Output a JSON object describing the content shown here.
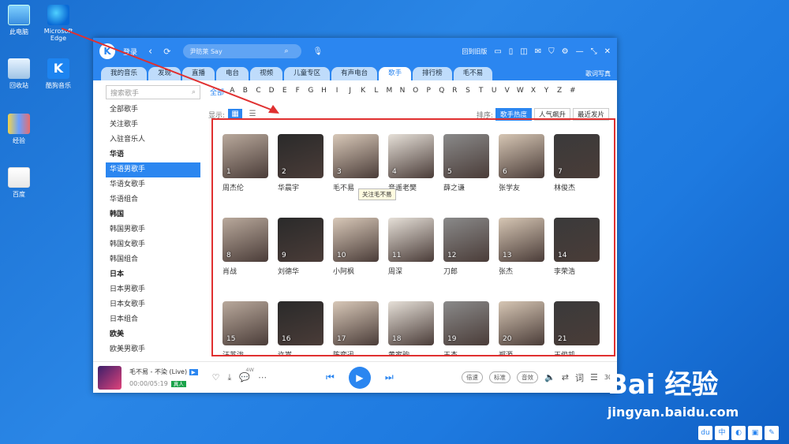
{
  "desktop": {
    "icons": [
      {
        "label": "此电脑"
      },
      {
        "label": "Microsoft Edge"
      },
      {
        "label": "回收站"
      },
      {
        "label": "酷狗音乐"
      },
      {
        "label": "经验"
      },
      {
        "label": "百度"
      }
    ]
  },
  "app": {
    "logo": "K",
    "login": "登录",
    "search_placeholder": "尹昉莱 Say",
    "back_to_old": "回到旧版",
    "tabs": [
      {
        "label": "我的音乐"
      },
      {
        "label": "发现"
      },
      {
        "label": "直播"
      },
      {
        "label": "电台"
      },
      {
        "label": "视频"
      },
      {
        "label": "儿童专区"
      },
      {
        "label": "有声电台"
      },
      {
        "label": "歌手",
        "active": true
      },
      {
        "label": "排行榜"
      },
      {
        "label": "毛不易"
      }
    ],
    "lyrics_tab": "歌词写真"
  },
  "sidebar": {
    "search_placeholder": "搜索歌手",
    "items": [
      {
        "label": "全部歌手"
      },
      {
        "label": "关注歌手"
      },
      {
        "label": "入驻音乐人"
      },
      {
        "label": "华语",
        "group": true
      },
      {
        "label": "华语男歌手",
        "active": true
      },
      {
        "label": "华语女歌手"
      },
      {
        "label": "华语组合"
      },
      {
        "label": "韩国",
        "group": true
      },
      {
        "label": "韩国男歌手"
      },
      {
        "label": "韩国女歌手"
      },
      {
        "label": "韩国组合"
      },
      {
        "label": "日本",
        "group": true
      },
      {
        "label": "日本男歌手"
      },
      {
        "label": "日本女歌手"
      },
      {
        "label": "日本组合"
      },
      {
        "label": "欧美",
        "group": true
      },
      {
        "label": "欧美男歌手"
      }
    ]
  },
  "letters": [
    "全部",
    "A",
    "B",
    "C",
    "D",
    "E",
    "F",
    "G",
    "H",
    "I",
    "J",
    "K",
    "L",
    "M",
    "N",
    "O",
    "P",
    "Q",
    "R",
    "S",
    "T",
    "U",
    "V",
    "W",
    "X",
    "Y",
    "Z",
    "#"
  ],
  "controls": {
    "display_label": "显示:",
    "sort_label": "排序:",
    "sort_options": [
      {
        "label": "歌手热度",
        "active": true
      },
      {
        "label": "人气飙升"
      },
      {
        "label": "最近发片"
      }
    ]
  },
  "singers": [
    {
      "num": "1",
      "name": "周杰伦"
    },
    {
      "num": "2",
      "name": "华晨宇"
    },
    {
      "num": "3",
      "name": "毛不易"
    },
    {
      "num": "4",
      "name": "音遥老樊"
    },
    {
      "num": "5",
      "name": "薛之谦"
    },
    {
      "num": "6",
      "name": "张学友"
    },
    {
      "num": "7",
      "name": "林俊杰"
    },
    {
      "num": "8",
      "name": "肖战"
    },
    {
      "num": "9",
      "name": "刘德华"
    },
    {
      "num": "10",
      "name": "小阿枫"
    },
    {
      "num": "11",
      "name": "周深"
    },
    {
      "num": "12",
      "name": "刀郎"
    },
    {
      "num": "13",
      "name": "张杰"
    },
    {
      "num": "14",
      "name": "李荣浩"
    },
    {
      "num": "15",
      "name": "汪苏泷"
    },
    {
      "num": "16",
      "name": "许嵩"
    },
    {
      "num": "17",
      "name": "陈奕迅"
    },
    {
      "num": "18",
      "name": "黄家驹"
    },
    {
      "num": "19",
      "name": "王杰"
    },
    {
      "num": "20",
      "name": "郑源"
    },
    {
      "num": "21",
      "name": "王俊凯"
    }
  ],
  "tooltip": "关注毛不易",
  "player": {
    "song": "毛不易 - 不染 (Live)",
    "time": "00:00/05:19",
    "badge": "真人",
    "comment_count": "4W",
    "speed": "倍速",
    "quality": "标准",
    "effect": "音效",
    "lyrics": "词",
    "playlist_count": "30"
  },
  "watermark": {
    "brand": "Bai 经验",
    "url": "jingyan.baidu.com"
  }
}
